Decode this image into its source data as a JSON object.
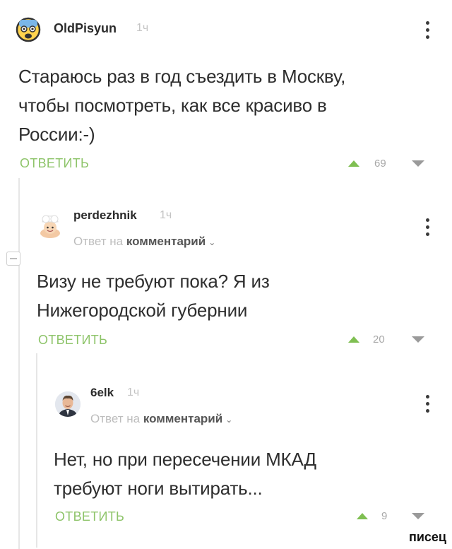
{
  "comments": [
    {
      "username": "OldPisyun",
      "time": "1ч",
      "text_lines": [
        "Стараюсь раз в год съездить в Москву,",
        "чтобы посмотреть, как все красиво в",
        "России:-)"
      ],
      "reply_label": "ОТВЕТИТЬ",
      "score": "69",
      "avatar_icon": "anxious-face-emoji-icon"
    },
    {
      "username": "perdezhnik",
      "time": "1ч",
      "reply_prefix": "Ответ на",
      "reply_target": "комментарий",
      "text_lines": [
        "Визу не требуют пока? Я из",
        "Нижегородской губернии"
      ],
      "reply_label": "ОТВЕТИТЬ",
      "score": "20",
      "avatar_icon": "chef-avatar-icon"
    },
    {
      "username": "6elk",
      "time": "1ч",
      "reply_prefix": "Ответ на",
      "reply_target": "комментарий",
      "text_lines": [
        "Нет, но при пересечении МКАД",
        "требуют ноги вытирать..."
      ],
      "reply_label": "ОТВЕТИТЬ",
      "score": "9",
      "avatar_icon": "man-photo-avatar-icon"
    }
  ],
  "watermark": "писец",
  "colors": {
    "accent_green": "#8ec46a",
    "upvote_green": "#7fbf52",
    "text": "#2e2e2e",
    "muted": "#bdbdbd"
  }
}
